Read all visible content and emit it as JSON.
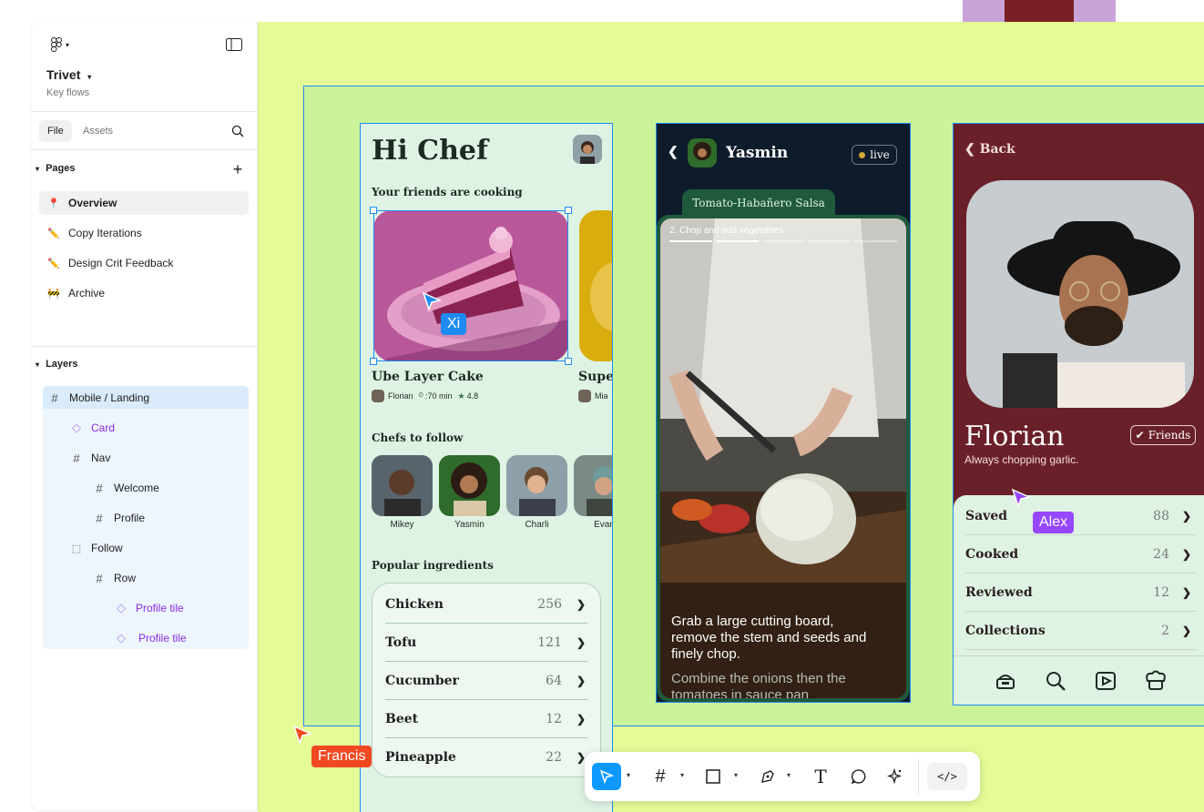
{
  "colors": {
    "canvas": "#e4fb96",
    "frame_highlight": "#cbf49a",
    "selection": "#1e8bf2",
    "card_bg": "#dff3e4",
    "dark_frame": "#0d1b2a",
    "profile_frame": "#6a2029",
    "accent_green": "#1f5a3c",
    "cursor_xi": "#1e8bf2",
    "cursor_alex": "#9747ff",
    "cursor_francis": "#f24822"
  },
  "panel": {
    "file_name": "Trivet",
    "file_subtitle": "Key flows",
    "tabs": [
      "File",
      "Assets"
    ],
    "pages_title": "Pages",
    "pages": [
      {
        "emoji": "📍",
        "label": "Overview",
        "active": true
      },
      {
        "emoji": "✏️",
        "label": "Copy Iterations",
        "active": false
      },
      {
        "emoji": "✏️",
        "label": "Design Crit Feedback",
        "active": false
      },
      {
        "emoji": "🚧",
        "label": "Archive",
        "active": false
      }
    ],
    "layers_title": "Layers",
    "layers": [
      {
        "icon": "frame-icon",
        "label": "Mobile / Landing"
      },
      {
        "icon": "component-icon",
        "label": "Card"
      },
      {
        "icon": "frame-icon",
        "label": "Nav"
      },
      {
        "icon": "frame-icon",
        "label": "Welcome"
      },
      {
        "icon": "frame-icon",
        "label": "Profile"
      },
      {
        "icon": "section-icon",
        "label": "Follow"
      },
      {
        "icon": "frame-icon",
        "label": "Row"
      },
      {
        "icon": "component-icon",
        "label": "Profile tile"
      },
      {
        "icon": "component-icon",
        "label": "Profile tile"
      }
    ]
  },
  "landing": {
    "greeting": "Hi Chef",
    "friends_heading": "Your friends are cooking",
    "card1": {
      "title": "Ube Layer Cake",
      "author": "Florian",
      "time": ":70 min",
      "rating": "4.8"
    },
    "card2": {
      "title": "Super",
      "author": "Mia"
    },
    "chefs_heading": "Chefs to follow",
    "chefs": [
      "Mikey",
      "Yasmin",
      "Charli",
      "Evan"
    ],
    "ingredients_heading": "Popular ingredients",
    "ingredients": [
      {
        "name": "Chicken",
        "count": "256"
      },
      {
        "name": "Tofu",
        "count": "121"
      },
      {
        "name": "Cucumber",
        "count": "64"
      },
      {
        "name": "Beet",
        "count": "12"
      },
      {
        "name": "Pineapple",
        "count": "22"
      }
    ]
  },
  "video": {
    "host": "Yasmin",
    "live_label": "live",
    "recipe_tab": "Tomato-Habañero Salsa",
    "step": "2.",
    "step_label": "Chop and add vegetables",
    "caption_main": "Grab a large cutting board, remove the stem and seeds and finely chop.",
    "caption_next": "Combine the onions then the tomatoes in sauce pan"
  },
  "profile": {
    "back_label": "Back",
    "name": "Florian",
    "friends_badge": "Friends",
    "bio": "Always chopping garlic.",
    "stats": [
      {
        "label": "Saved",
        "count": "88"
      },
      {
        "label": "Cooked",
        "count": "24"
      },
      {
        "label": "Reviewed",
        "count": "12"
      },
      {
        "label": "Collections",
        "count": "2"
      }
    ],
    "tab_icons": [
      "cookbook-icon",
      "search-icon",
      "play-icon",
      "chef-hat-icon"
    ]
  },
  "cursors": {
    "xi": "Xi",
    "alex": "Alex",
    "francis": "Francis"
  },
  "toolbar": {
    "tools": [
      "move-tool",
      "frame-tool",
      "shape-tool",
      "pen-tool",
      "text-tool",
      "comment-tool",
      "actions-tool",
      "dev-mode-toggle"
    ]
  }
}
